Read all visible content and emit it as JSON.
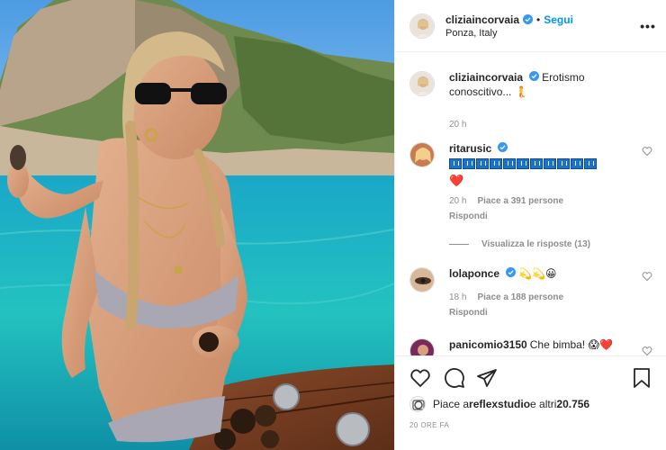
{
  "post": {
    "author": "cliziaincorvaia",
    "follow_label": "Segui",
    "location": "Ponza, Italy",
    "more_label": "•••",
    "dot": "•"
  },
  "caption": {
    "username": "cliziaincorvaia",
    "text": "Erotismo conoscitivo... 🧜",
    "time": "20 h"
  },
  "comments": [
    {
      "username": "ritarusic",
      "heart": "❤️",
      "time": "20 h",
      "likes": "Piace a 391 persone",
      "reply": "Rispondi"
    },
    {
      "username": "lolaponce",
      "text": "💫💫😀",
      "time": "18 h",
      "likes": "Piace a 188 persone",
      "reply": "Rispondi"
    },
    {
      "username": "panicomio3150",
      "text": "Che bimba! 😱❤️"
    }
  ],
  "view_replies": "Visualizza le risposte (13)",
  "likes_summary": {
    "prefix": "Piace a ",
    "user": "reflexstudio",
    "suffix": " e altri ",
    "count": "20.756"
  },
  "time_ago": "20 ORE FA",
  "colors": {
    "accent": "#0095f6",
    "text": "#262626",
    "muted": "#8e8e8e",
    "sea": "#1fb3c4",
    "sky": "#5fa8e6"
  },
  "icons": [
    "verified-icon",
    "more-icon",
    "heart-icon",
    "comment-icon",
    "share-icon",
    "save-icon"
  ]
}
